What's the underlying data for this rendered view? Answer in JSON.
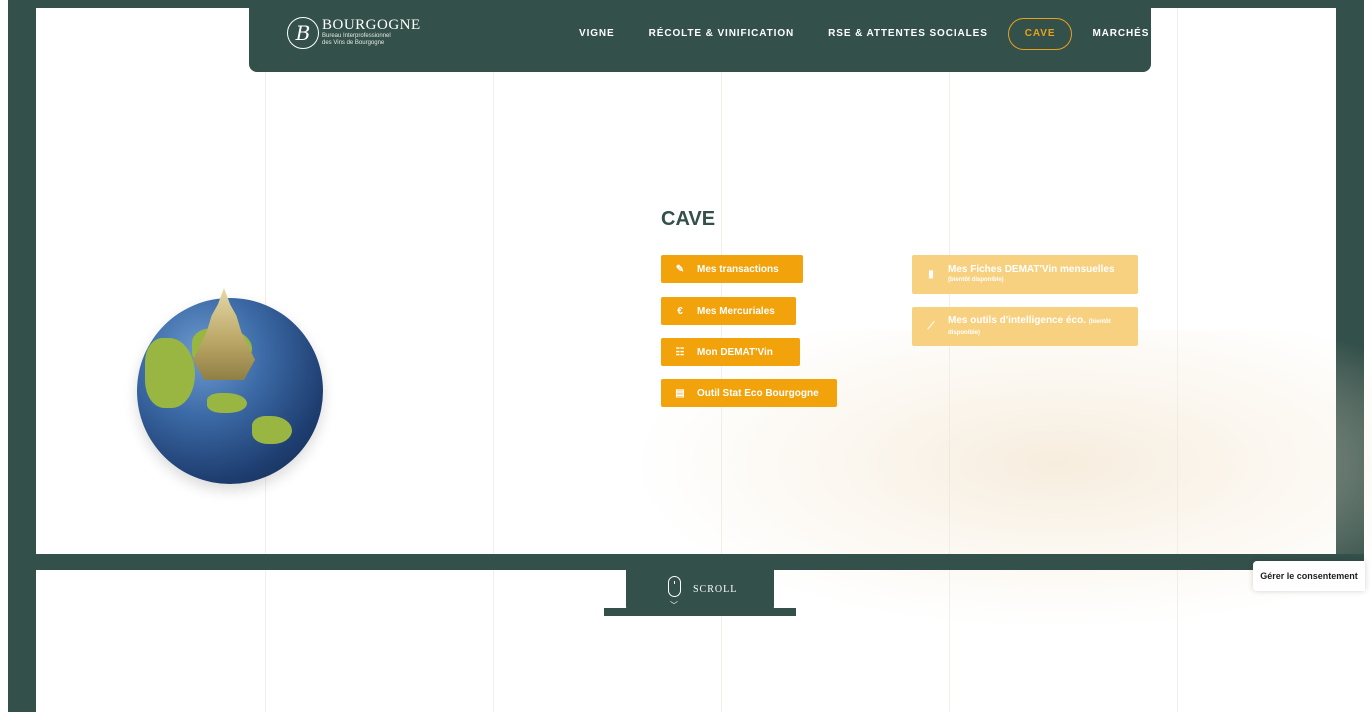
{
  "header": {
    "logo": {
      "initial": "B",
      "name": "BOURGOGNE",
      "subtitle_line1": "Bureau Interprofessionnel",
      "subtitle_line2": "des Vins de Bourgogne"
    },
    "nav": [
      {
        "label": "VIGNE",
        "active": false
      },
      {
        "label": "RÉCOLTE & VINIFICATION",
        "active": false
      },
      {
        "label": "RSE & ATTENTES SOCIALES",
        "active": false
      },
      {
        "label": "CAVE",
        "active": true
      },
      {
        "label": "MARCHÉS",
        "active": false
      }
    ]
  },
  "main": {
    "title": "CAVE",
    "buttons": [
      {
        "label": "Mes transactions",
        "icon": "edit-icon",
        "glyph": "✎"
      },
      {
        "label": "Mes Mercuriales",
        "icon": "euro-icon",
        "glyph": "€"
      },
      {
        "label": "Mon DEMAT'Vin",
        "icon": "sitemap-icon",
        "glyph": "☷"
      },
      {
        "label": "Outil Stat Eco Bourgogne",
        "icon": "table-icon",
        "glyph": "▤"
      }
    ],
    "disabled_buttons": [
      {
        "label": "Mes Fiches DEMAT'Vin mensuelles",
        "note": "(bientôt disponible)",
        "icon": "clipboard-icon",
        "glyph": "▮"
      },
      {
        "label": "Mes outils d'intelligence éco.",
        "note_inline": "(bientôt",
        "note": "disponible)",
        "icon": "chart-line-icon",
        "glyph": "⟋"
      }
    ]
  },
  "scroll": {
    "label": "SCROLL"
  },
  "consent": {
    "label": "Gérer le consentement"
  },
  "colors": {
    "primary": "#34504a",
    "accent": "#f2a20b",
    "accent_disabled": "#f8d180",
    "nav_active": "#e8a21a"
  }
}
